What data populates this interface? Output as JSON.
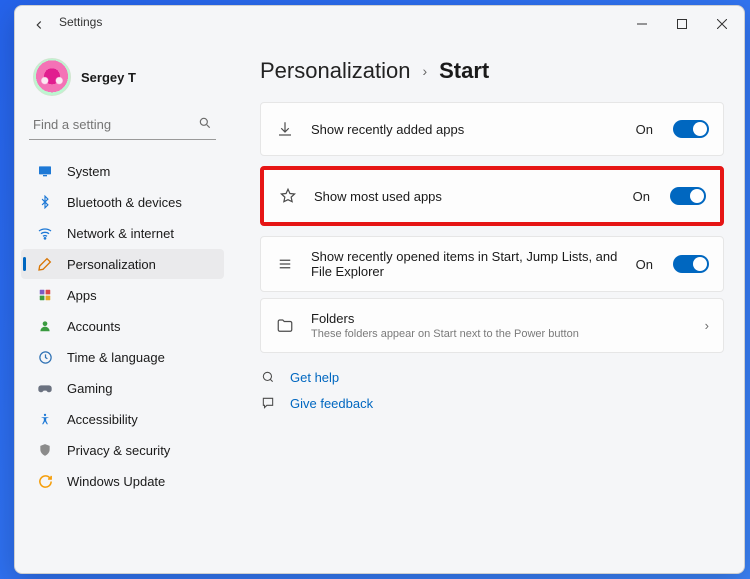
{
  "window": {
    "title": "Settings"
  },
  "user": {
    "name": "Sergey T"
  },
  "search": {
    "placeholder": "Find a setting"
  },
  "sidebar": {
    "items": [
      {
        "label": "System",
        "icon": "display"
      },
      {
        "label": "Bluetooth & devices",
        "icon": "bluetooth"
      },
      {
        "label": "Network & internet",
        "icon": "wifi"
      },
      {
        "label": "Personalization",
        "icon": "brush",
        "active": true
      },
      {
        "label": "Apps",
        "icon": "apps"
      },
      {
        "label": "Accounts",
        "icon": "person"
      },
      {
        "label": "Time & language",
        "icon": "clock"
      },
      {
        "label": "Gaming",
        "icon": "game"
      },
      {
        "label": "Accessibility",
        "icon": "access"
      },
      {
        "label": "Privacy & security",
        "icon": "shield"
      },
      {
        "label": "Windows Update",
        "icon": "update"
      }
    ]
  },
  "breadcrumb": {
    "parent": "Personalization",
    "current": "Start"
  },
  "settings": [
    {
      "label": "Show recently added apps",
      "state": "On",
      "icon": "download"
    },
    {
      "label": "Show most used apps",
      "state": "On",
      "icon": "star",
      "highlight": true
    },
    {
      "label": "Show recently opened items in Start, Jump Lists, and File Explorer",
      "state": "On",
      "icon": "list"
    }
  ],
  "folders": {
    "label": "Folders",
    "sub": "These folders appear on Start next to the Power button"
  },
  "links": {
    "help": "Get help",
    "feedback": "Give feedback"
  }
}
